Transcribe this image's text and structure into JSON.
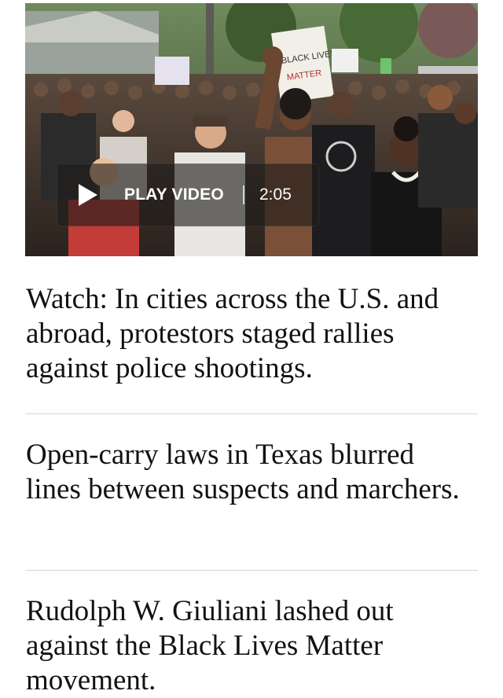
{
  "video": {
    "play_label": "PLAY VIDEO",
    "duration": "2:05",
    "sign_text_1": "BLACK LIVES",
    "sign_text_2": "MATTER"
  },
  "headlines": [
    {
      "text": "Watch: In cities across the U.S. and abroad, protestors staged rallies against police shootings."
    },
    {
      "text": "Open-carry laws in Texas blurred lines between suspects and marchers."
    },
    {
      "text": "Rudolph W. Giuliani lashed out against the Black Lives Matter movement."
    }
  ],
  "colors": {
    "headline": "#121212",
    "divider": "#d6d6d6",
    "overlay": "rgba(30,28,26,0.62)",
    "play_text": "#ffffff"
  },
  "icons": {
    "play": "play-icon"
  }
}
